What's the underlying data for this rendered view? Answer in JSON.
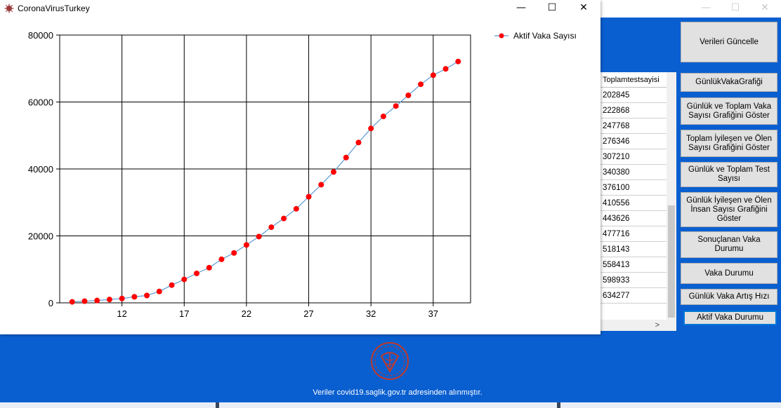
{
  "main_window": {
    "controls": {
      "minimize": "—",
      "maximize": "☐",
      "close": "✕"
    },
    "update_button": "Verileri Güncelle",
    "grid": {
      "header": "Toplamtestsayisi",
      "values": [
        "202845",
        "222868",
        "247768",
        "276346",
        "307210",
        "340380",
        "376100",
        "410556",
        "443626",
        "477716",
        "518143",
        "558413",
        "598933",
        "634277"
      ]
    },
    "hscroll_arrow": ">",
    "buttons": [
      "GünlükVakaGrafiği",
      "Günlük ve Toplam Vaka Sayısı Grafiğini Göster",
      "Toplam İyileşen ve Ölen Sayısı Grafiğini Göster",
      "Günlük ve Toplam Test Sayısı",
      "Günlük İyileşen ve Ölen İnsan Sayısı Grafiğini Göster",
      "Sonuçlanan Vaka Durumu",
      "Vaka Durumu",
      "Günlük Vaka Artış Hızı",
      "Aktif Vaka Durumu"
    ],
    "footer_note": "Veriler covid19.saglik.gov.tr adresinden alınmıştır."
  },
  "chart_window": {
    "title": "CoronaVirusTurkey",
    "controls": {
      "minimize": "—",
      "maximize": "☐",
      "close": "✕"
    }
  },
  "colors": {
    "main_bg": "#0a5fd0",
    "line": "#5b9bd5",
    "marker": "#ff0000",
    "logo": "#c0392b"
  },
  "chart_data": {
    "type": "line",
    "title": "",
    "xlabel": "",
    "ylabel": "",
    "x_ticks": [
      12,
      17,
      22,
      27,
      32,
      37
    ],
    "y_ticks": [
      0,
      20000,
      40000,
      60000,
      80000
    ],
    "xlim": [
      7,
      40
    ],
    "ylim": [
      0,
      80000
    ],
    "grid": true,
    "legend_position": "top-right",
    "series": [
      {
        "name": "Aktif Vaka Sayısı",
        "x": [
          8,
          9,
          10,
          11,
          12,
          13,
          14,
          15,
          16,
          17,
          18,
          19,
          20,
          21,
          22,
          23,
          24,
          25,
          26,
          27,
          28,
          29,
          30,
          31,
          32,
          33,
          34,
          35,
          36,
          37,
          38,
          39
        ],
        "values": [
          300,
          500,
          700,
          1000,
          1300,
          1800,
          2200,
          3400,
          5300,
          7000,
          8800,
          10500,
          13000,
          14900,
          17300,
          19800,
          22600,
          25200,
          28100,
          31700,
          35300,
          39100,
          43400,
          47900,
          52100,
          55700,
          58800,
          62000,
          65300,
          68000,
          69900,
          72100
        ]
      }
    ]
  }
}
